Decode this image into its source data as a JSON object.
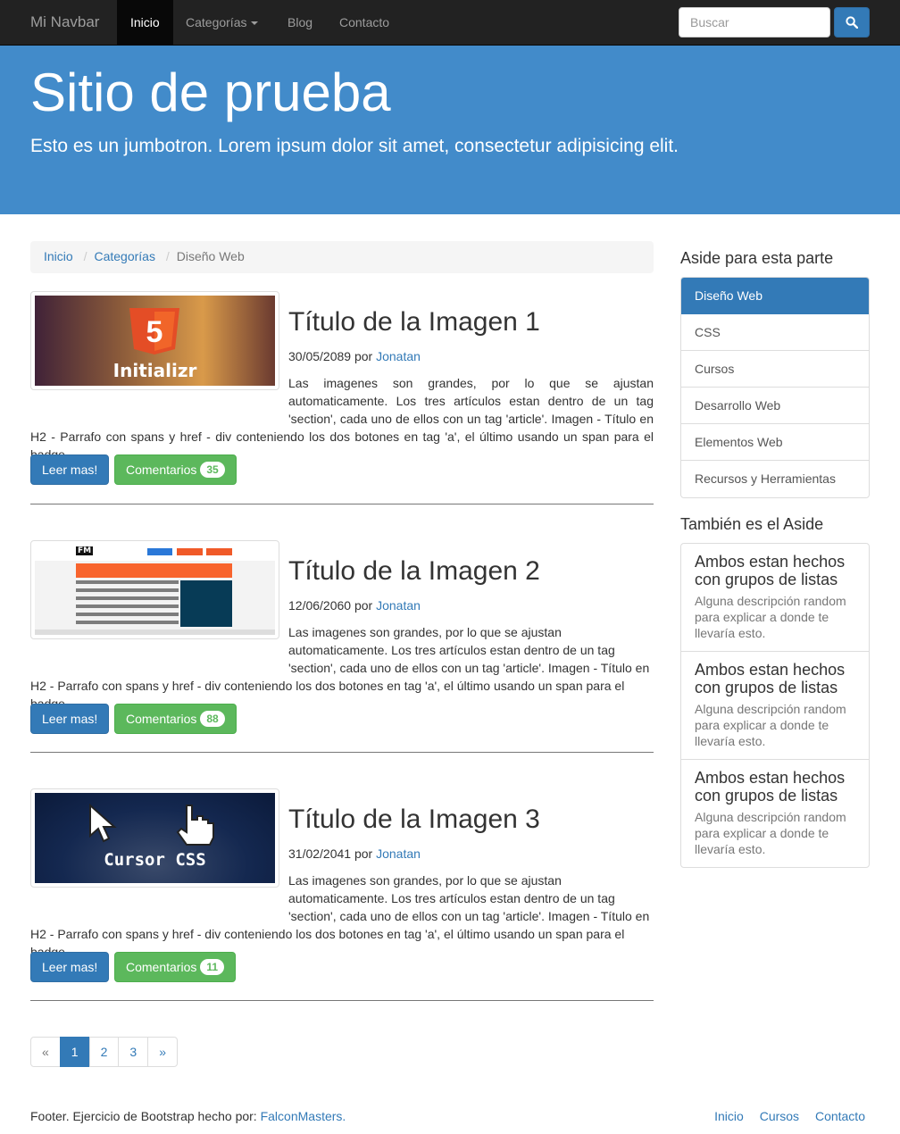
{
  "navbar": {
    "brand": "Mi Navbar",
    "items": [
      {
        "label": "Inicio"
      },
      {
        "label": "Categorías"
      },
      {
        "label": "Blog"
      },
      {
        "label": "Contacto"
      }
    ],
    "search_placeholder": "Buscar"
  },
  "jumbotron": {
    "title": "Sitio de prueba",
    "text": "Esto es un jumbotron. Lorem ipsum dolor sit amet, consectetur adipisicing elit."
  },
  "breadcrumb": [
    "Inicio",
    "Categorías",
    "Diseño Web"
  ],
  "articles": [
    {
      "title": "Título de la Imagen 1",
      "date": "30/05/2089",
      "by": "por",
      "author": "Jonatan",
      "text": "Las imagenes son grandes, por lo que se ajustan automaticamente. Los tres artículos estan dentro de un tag 'section', cada uno de ellos con un tag 'article'. Imagen - Título en H2 - Parrafo con spans y href - div conteniendo los dos botones en tag 'a', el último usando un span para el badge.",
      "read_more": "Leer mas!",
      "comments": "Comentarios",
      "count": "35",
      "image_caption": "Initializr"
    },
    {
      "title": "Título de la Imagen 2",
      "date": "12/06/2060",
      "by": "por",
      "author": "Jonatan",
      "text": "Las imagenes son grandes, por lo que se ajustan automaticamente. Los tres artículos estan dentro de un tag 'section', cada uno de ellos con un tag 'article'. Imagen - Título en H2 - Parrafo con spans y href - div conteniendo los dos botones en tag 'a', el último usando un span para el badge.",
      "read_more": "Leer mas!",
      "comments": "Comentarios",
      "count": "88",
      "image_caption": "FM"
    },
    {
      "title": "Título de la Imagen 3",
      "date": "31/02/2041",
      "by": "por",
      "author": "Jonatan",
      "text": "Las imagenes son grandes, por lo que se ajustan automaticamente. Los tres artículos estan dentro de un tag 'section', cada uno de ellos con un tag 'article'. Imagen - Título en H2 - Parrafo con spans y href - div conteniendo los dos botones en tag 'a', el último usando un span para el badge.",
      "read_more": "Leer mas!",
      "comments": "Comentarios",
      "count": "11",
      "image_caption": "Cursor CSS"
    }
  ],
  "pagination": [
    "«",
    "1",
    "2",
    "3",
    "»"
  ],
  "aside": {
    "heading1": "Aside para esta parte",
    "list": [
      "Diseño Web",
      "CSS",
      "Cursos",
      "Desarrollo Web",
      "Elementos Web",
      "Recursos y Herramientas"
    ],
    "heading2": "También es el Aside",
    "cards": [
      {
        "title": "Ambos estan hechos con grupos de listas",
        "text": "Alguna descripción random para explicar a donde te llevaría esto."
      },
      {
        "title": "Ambos estan hechos con grupos de listas",
        "text": "Alguna descripción random para explicar a donde te llevaría esto."
      },
      {
        "title": "Ambos estan hechos con grupos de listas",
        "text": "Alguna descripción random para explicar a donde te llevaría esto."
      }
    ]
  },
  "footer": {
    "text": "Footer. Ejercicio de Bootstrap hecho por:",
    "link": "FalconMasters.",
    "links": [
      "Inicio",
      "Cursos",
      "Contacto"
    ]
  },
  "colors": {
    "navbar": "#222222",
    "jumbotron": "#428bca",
    "primary": "#337ab7",
    "success": "#5cb85c"
  }
}
